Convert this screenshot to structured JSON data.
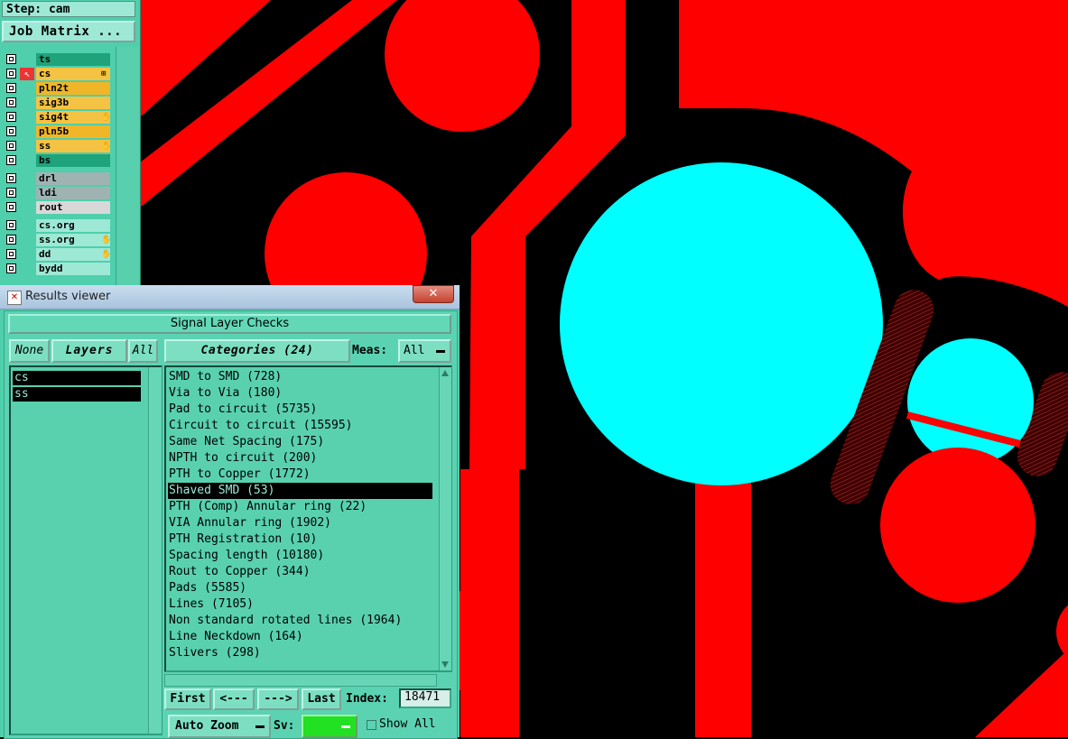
{
  "step_label": "Step: cam",
  "job_matrix_label": "Job Matrix ...",
  "layer_groups": [
    [
      {
        "name": "ts",
        "color": "#1fa37a",
        "mark": ""
      },
      {
        "name": "cs",
        "color": "#f5c343",
        "mark": "⊞",
        "selected": true
      },
      {
        "name": "pln2t",
        "color": "#f0b628",
        "mark": ""
      },
      {
        "name": "sig3b",
        "color": "#f5c343",
        "mark": ""
      },
      {
        "name": "sig4t",
        "color": "#f5c343",
        "mark": "✋"
      },
      {
        "name": "pln5b",
        "color": "#f0b628",
        "mark": ""
      },
      {
        "name": "ss",
        "color": "#f5c343",
        "mark": "✋"
      },
      {
        "name": "bs",
        "color": "#1fa37a",
        "mark": ""
      }
    ],
    [
      {
        "name": "drl",
        "color": "#9fb3b3",
        "mark": ""
      },
      {
        "name": "ldi",
        "color": "#9fb3b3",
        "mark": ""
      },
      {
        "name": "rout",
        "color": "#d8d8d8",
        "mark": ""
      }
    ],
    [
      {
        "name": "cs.org",
        "color": "#9ee8d6",
        "mark": ""
      },
      {
        "name": "ss.org",
        "color": "#9ee8d6",
        "mark": "✋"
      },
      {
        "name": "dd",
        "color": "#9ee8d6",
        "mark": "✋"
      },
      {
        "name": "bydd",
        "color": "#9ee8d6",
        "mark": ""
      }
    ]
  ],
  "viewer": {
    "title": "Results viewer",
    "close_label": "✕",
    "group_title": "Signal Layer Checks",
    "none_label": "None",
    "layers_label": "Layers",
    "all_label": "All",
    "categories_label": "Categories (24)",
    "meas_label": "Meas:",
    "meas_value": "All",
    "layers": [
      "cs",
      "ss"
    ],
    "categories": [
      "SMD to SMD (728)",
      "Via to Via (180)",
      "Pad to circuit (5735)",
      "Circuit to circuit (15595)",
      "Same Net Spacing (175)",
      "NPTH to circuit (200)",
      "PTH to Copper (1772)",
      "Shaved SMD (53)",
      "PTH (Comp) Annular ring (22)",
      "VIA Annular ring (1902)",
      "PTH Registration (10)",
      "Spacing length (10180)",
      "Rout to Copper (344)",
      "Pads (5585)",
      "Lines (7105)",
      "Non standard rotated lines (1964)",
      "Line Neckdown (164)",
      "Slivers (298)"
    ],
    "selected_category_index": 7,
    "first_label": "First",
    "prev_label": "<---",
    "next_label": "--->",
    "last_label": "Last",
    "index_label": "Index:",
    "index_value": "18471",
    "auto_zoom_label": "Auto Zoom",
    "sv_label": "Sv:",
    "show_all_label": "Show All"
  },
  "colors": {
    "copper": "#ff0000",
    "drill": "#00ffff",
    "background": "#000000",
    "panel": "#4fcfac"
  }
}
